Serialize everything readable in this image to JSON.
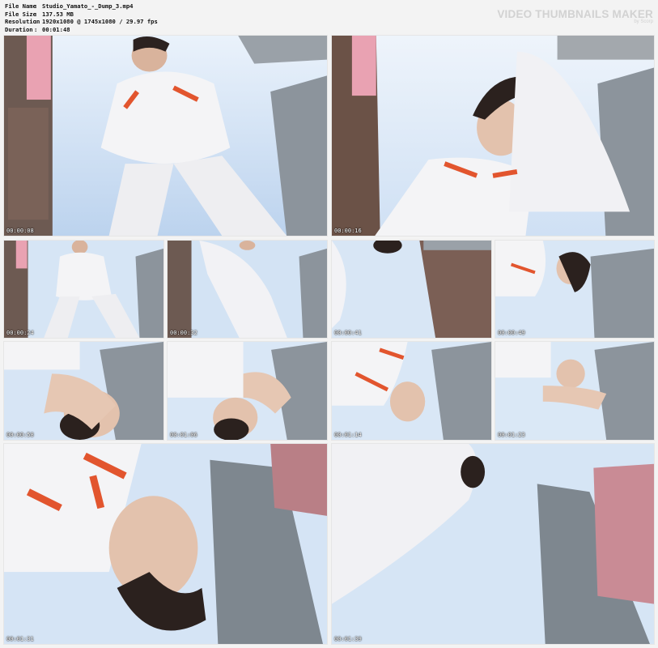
{
  "header": {
    "file_name_label": "File Name",
    "file_name": "Studio_Yamato_-_Dump_3.mp4",
    "file_size_label": "File Size",
    "file_size": "137.53 MB",
    "resolution_label": "Resolution",
    "resolution": "1920x1080 @ 1745x1080 / 29.97 fps",
    "duration_label": "Duration",
    "duration": "00:01:48",
    "brand_title": "VIDEO THUMBNAILS MAKER",
    "brand_sub": "by Scorp"
  },
  "thumbnails": [
    {
      "timestamp": "00:00:08"
    },
    {
      "timestamp": "00:00:16"
    },
    {
      "timestamp": "00:00:24"
    },
    {
      "timestamp": "00:00:32"
    },
    {
      "timestamp": "00:00:41"
    },
    {
      "timestamp": "00:00:49"
    },
    {
      "timestamp": "00:00:58"
    },
    {
      "timestamp": "00:01:06"
    },
    {
      "timestamp": "00:01:14"
    },
    {
      "timestamp": "00:01:23"
    },
    {
      "timestamp": "00:01:31"
    },
    {
      "timestamp": "00:01:39"
    }
  ],
  "colors": {
    "sky": "#cfe0f4",
    "suit": "#f4f4f6",
    "suit_red": "#e2552e",
    "building_dark": "#5b4a44",
    "building_glass": "#8c949c",
    "sign_pink": "#e9a2b2"
  }
}
